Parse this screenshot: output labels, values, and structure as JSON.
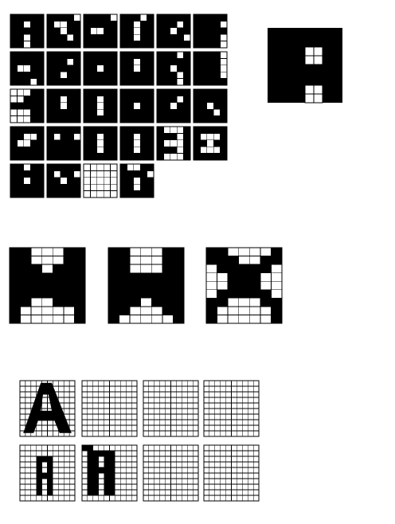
{
  "colors": {
    "ink": "#000000",
    "paper": "#ffffff",
    "grid": "#000000"
  },
  "glyph_atlas": {
    "tiles": [
      {
        "name": "glyph-a",
        "rows": [
          "11111",
          "11011",
          "11111",
          "11011",
          "11011"
        ]
      },
      {
        "name": "glyph-b",
        "rows": [
          "11110",
          "10011",
          "11011",
          "11101",
          "11111"
        ]
      },
      {
        "name": "glyph-c",
        "rows": [
          "11110",
          "11111",
          "10011",
          "11111",
          "11111"
        ]
      },
      {
        "name": "glyph-d",
        "rows": [
          "11101",
          "11011",
          "11011",
          "11011",
          "11111"
        ]
      },
      {
        "name": "glyph-e",
        "rows": [
          "11111",
          "11101",
          "11011",
          "11110",
          "11111"
        ]
      },
      {
        "name": "glyph-f",
        "rows": [
          "11111",
          "11110",
          "11111",
          "11110",
          "11110"
        ]
      },
      {
        "name": "glyph-g",
        "rows": [
          "11111",
          "11111",
          "10011",
          "11111",
          "11101"
        ]
      },
      {
        "name": "glyph-h",
        "rows": [
          "11111",
          "11101",
          "11111",
          "11011",
          "11111"
        ]
      },
      {
        "name": "glyph-i",
        "rows": [
          "11111",
          "11111",
          "11011",
          "11111",
          "11111"
        ]
      },
      {
        "name": "glyph-j",
        "rows": [
          "11111",
          "11011",
          "11011",
          "11111",
          "11111"
        ]
      },
      {
        "name": "glyph-k",
        "rows": [
          "11101",
          "11111",
          "11011",
          "11101",
          "11101"
        ]
      },
      {
        "name": "glyph-l",
        "rows": [
          "11110",
          "11110",
          "11110",
          "11110",
          "11111"
        ]
      },
      {
        "name": "glyph-m",
        "rows": [
          "00011",
          "00111",
          "11111",
          "00011",
          "00011"
        ]
      },
      {
        "name": "glyph-n",
        "rows": [
          "11111",
          "11011",
          "11011",
          "11111",
          "11111"
        ]
      },
      {
        "name": "glyph-o",
        "rows": [
          "11111",
          "11011",
          "11011",
          "11011",
          "11111"
        ]
      },
      {
        "name": "glyph-p",
        "rows": [
          "11111",
          "11111",
          "11011",
          "11111",
          "11111"
        ]
      },
      {
        "name": "glyph-q",
        "rows": [
          "11111",
          "11101",
          "11011",
          "11111",
          "11111"
        ]
      },
      {
        "name": "glyph-r",
        "rows": [
          "11111",
          "11111",
          "11011",
          "11101",
          "11111"
        ]
      },
      {
        "name": "glyph-s",
        "rows": [
          "11111",
          "11001",
          "10011",
          "11111",
          "11111"
        ]
      },
      {
        "name": "glyph-t",
        "rows": [
          "11111",
          "10110",
          "11111",
          "11111",
          "11111"
        ]
      },
      {
        "name": "glyph-u",
        "rows": [
          "11111",
          "11011",
          "11011",
          "11011",
          "11111"
        ]
      },
      {
        "name": "glyph-v",
        "rows": [
          "11111",
          "11011",
          "11011",
          "11011",
          "11111"
        ]
      },
      {
        "name": "glyph-w",
        "rows": [
          "10001",
          "11101",
          "10001",
          "11101",
          "10001"
        ]
      },
      {
        "name": "glyph-x",
        "rows": [
          "11111",
          "10001",
          "11011",
          "10001",
          "11111"
        ]
      },
      {
        "name": "glyph-y",
        "rows": [
          "11011",
          "11111",
          "11011",
          "11111",
          "11111"
        ]
      },
      {
        "name": "glyph-z",
        "rows": [
          "11111",
          "10110",
          "11011",
          "11111",
          "11111"
        ]
      },
      {
        "name": "glyph-blank",
        "rows": [
          "00000",
          "00000",
          "00000",
          "00000",
          "00000"
        ]
      },
      {
        "name": "glyph-seven",
        "rows": [
          "10011",
          "11110",
          "11011",
          "11011",
          "11111"
        ]
      }
    ]
  },
  "preview_glyph": {
    "name": "preview-a",
    "rows": [
      "11111",
      "11111",
      "11001",
      "11001",
      "11111",
      "11111",
      "11001",
      "11001",
      "11111"
    ]
  },
  "feature_maps": [
    {
      "name": "feature-map-m",
      "rows": [
        "1100011",
        "1100011",
        "1110111",
        "1111111",
        "1111111",
        "1111111",
        "1100111",
        "1000001",
        "1000001"
      ]
    },
    {
      "name": "feature-map-w",
      "rows": [
        "1100011",
        "1100011",
        "1100011",
        "1111111",
        "1111111",
        "1111111",
        "1110111",
        "1100011",
        "1000001"
      ]
    },
    {
      "name": "feature-map-x",
      "rows": [
        "1100001",
        "1110011",
        "0111110",
        "0011100",
        "0011100",
        "0111110",
        "1100011",
        "1000001",
        "1000001"
      ]
    }
  ],
  "input_grids": {
    "rows": [
      [
        {
          "name": "input-grid-a-stroke",
          "rows": [
            "1111111111",
            "1100000011",
            "1001111001",
            "1011001101",
            "1010000101",
            "1011111101",
            "1011001101",
            "1010000101",
            "1100000011",
            "1111111111"
          ],
          "mode": "outline"
        },
        {
          "name": "input-grid-empty-1",
          "rows": [],
          "mode": "empty"
        },
        {
          "name": "input-grid-empty-2",
          "rows": [],
          "mode": "empty"
        },
        {
          "name": "input-grid-empty-3",
          "rows": [],
          "mode": "empty"
        }
      ],
      [
        {
          "name": "input-grid-a-narrow",
          "rows": [
            "0000000000",
            "0000000000",
            "0001110000",
            "0001010000",
            "0001010000",
            "0001110000",
            "0001010000",
            "0001010000",
            "0001010000",
            "0000000000"
          ],
          "mode": "fill"
        },
        {
          "name": "input-grid-a-wide",
          "rows": [
            "1100000000",
            "0111110000",
            "0110110000",
            "0110110000",
            "0111110000",
            "0110110000",
            "0110110000",
            "0110110000",
            "0110110000",
            "0000000000"
          ],
          "mode": "fill"
        },
        {
          "name": "input-grid-empty-4",
          "rows": [],
          "mode": "empty"
        },
        {
          "name": "input-grid-empty-5",
          "rows": [],
          "mode": "empty"
        }
      ]
    ]
  }
}
